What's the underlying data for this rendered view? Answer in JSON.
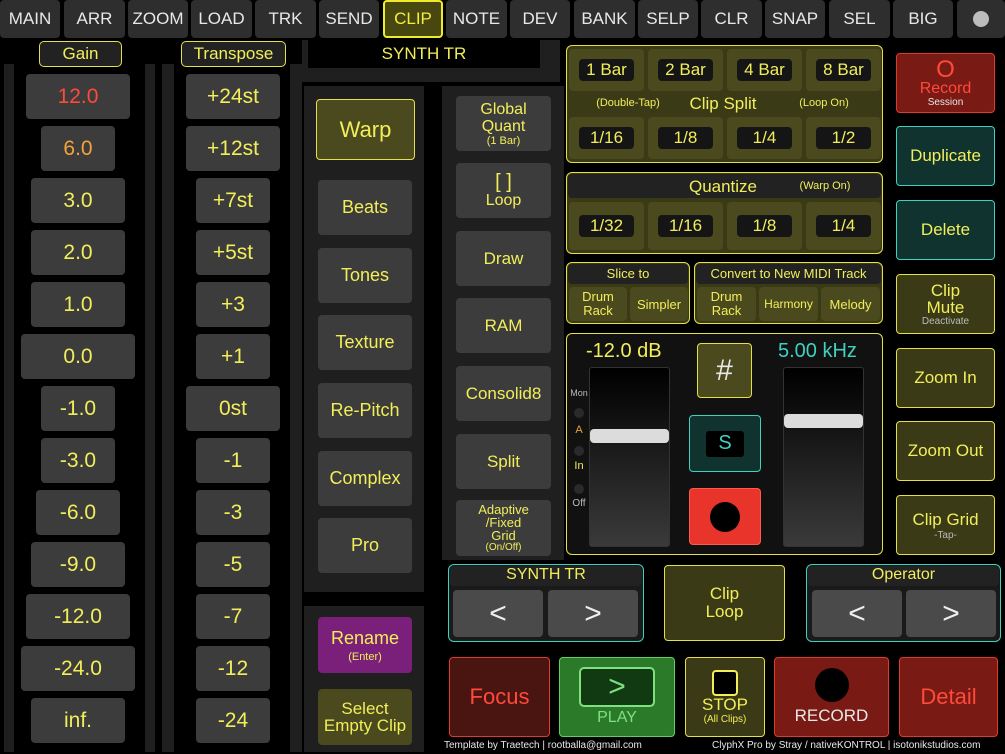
{
  "tabs": [
    {
      "label": "MAIN",
      "active": false
    },
    {
      "label": "ARR",
      "active": false
    },
    {
      "label": "ZOOM",
      "active": false
    },
    {
      "label": "LOAD",
      "active": false
    },
    {
      "label": "TRK",
      "active": false
    },
    {
      "label": "SEND",
      "active": false
    },
    {
      "label": "CLIP",
      "active": true
    },
    {
      "label": "NOTE",
      "active": false
    },
    {
      "label": "DEV",
      "active": false
    },
    {
      "label": "BANK",
      "active": false
    },
    {
      "label": "SELP",
      "active": false
    },
    {
      "label": "CLR",
      "active": false
    },
    {
      "label": "SNAP",
      "active": false
    },
    {
      "label": "SEL",
      "active": false
    },
    {
      "label": "BIG",
      "active": false
    }
  ],
  "gain": {
    "title": "Gain",
    "values": [
      "12.0",
      "6.0",
      "3.0",
      "2.0",
      "1.0",
      "0.0",
      "-1.0",
      "-3.0",
      "-6.0",
      "-9.0",
      "-12.0",
      "-24.0",
      "inf."
    ]
  },
  "transpose": {
    "title": "Transpose",
    "values": [
      "+24st",
      "+12st",
      "+7st",
      "+5st",
      "+3",
      "+1",
      "0st",
      "-1",
      "-3",
      "-5",
      "-7",
      "-12",
      "-24"
    ]
  },
  "track_name": "SYNTH TR",
  "warp": {
    "warp_label": "Warp",
    "modes": [
      "Beats",
      "Tones",
      "Texture",
      "Re-Pitch",
      "Complex",
      "Pro"
    ]
  },
  "rename": {
    "label": "Rename",
    "sub": "(Enter)"
  },
  "select_empty": {
    "line1": "Select",
    "line2": "Empty Clip"
  },
  "tools": {
    "global_quant": {
      "line1": "Global",
      "line2": "Quant",
      "sub": "(1 Bar)"
    },
    "loop": {
      "glyph": "[ ]",
      "label": "Loop"
    },
    "draw": "Draw",
    "ram": "RAM",
    "consolid8": "Consolid8",
    "split": "Split",
    "adaptive": {
      "line1": "Adaptive",
      "line2": "/Fixed",
      "line3": "Grid",
      "sub": "(On/Off)"
    }
  },
  "clip_split": {
    "bars": [
      "1 Bar",
      "2 Bar",
      "4 Bar",
      "8 Bar"
    ],
    "title": "Clip Split",
    "left_note": "(Double-Tap)",
    "right_note": "(Loop On)",
    "divisions": [
      "1/16",
      "1/8",
      "1/4",
      "1/2"
    ]
  },
  "quantize": {
    "title": "Quantize",
    "note": "(Warp On)",
    "values": [
      "1/32",
      "1/16",
      "1/8",
      "1/4"
    ]
  },
  "slice_to": {
    "title": "Slice to",
    "items": [
      [
        "Drum",
        "Rack"
      ],
      [
        "Simpler"
      ]
    ]
  },
  "convert_midi": {
    "title": "Convert to New MIDI Track",
    "items": [
      [
        "Drum",
        "Rack"
      ],
      [
        "Harmony"
      ],
      [
        "Melody"
      ]
    ]
  },
  "mixer": {
    "volume_label": "-12.0 dB",
    "volume_level": 0.63,
    "freq_label": "5.00 kHz",
    "freq_level": 0.72,
    "monitor": [
      "Mon",
      "A",
      "In",
      "Off"
    ],
    "hash": "#",
    "solo": "S"
  },
  "right_column": {
    "record": {
      "glyph": "O",
      "label": "Record",
      "sub": "Session"
    },
    "duplicate": "Duplicate",
    "delete": "Delete",
    "clip_mute": {
      "line1": "Clip",
      "line2": "Mute",
      "sub": "Deactivate"
    },
    "zoom_in": "Zoom In",
    "zoom_out": "Zoom Out",
    "clip_grid": {
      "label": "Clip Grid",
      "sub": "-Tap-"
    }
  },
  "nav": {
    "track_title": "SYNTH TR",
    "device_title": "Operator",
    "prev": "<",
    "next": ">",
    "clip_loop": {
      "line1": "Clip",
      "line2": "Loop"
    }
  },
  "transport": {
    "focus": "Focus",
    "play_glyph": ">",
    "play": "PLAY",
    "stop": "STOP",
    "stop_sub": "(All Clips)",
    "record": "RECORD",
    "detail": "Detail"
  },
  "footer": {
    "left": "Template by Traetech | rootballa@gmail.com",
    "right": "ClyphX Pro by Stray / nativeKONTROL | isotonikstudios.com"
  },
  "colors": {
    "accent": "#f2ee5a",
    "record_red": "#e03a2a",
    "teal": "#3fd0c0",
    "play_green": "#2a7a2a",
    "rename_purple": "#7a1f7a"
  }
}
